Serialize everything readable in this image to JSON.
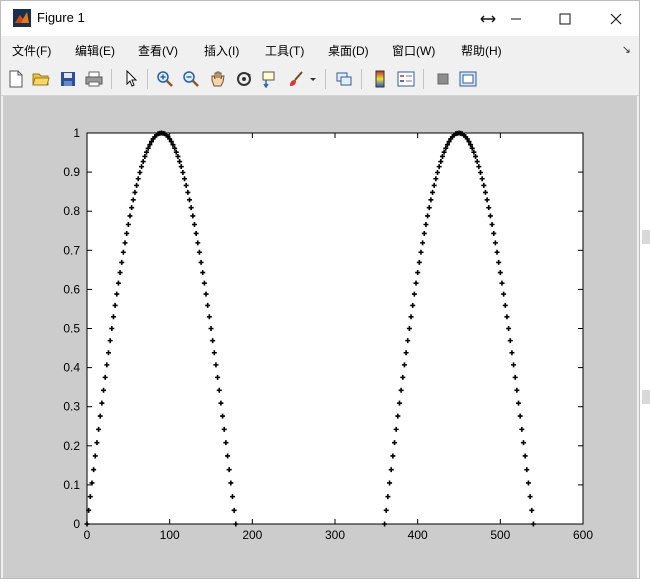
{
  "window": {
    "title": "Figure 1"
  },
  "menu": [
    {
      "id": "file",
      "label": "文件(F)"
    },
    {
      "id": "edit",
      "label": "编辑(E)"
    },
    {
      "id": "view",
      "label": "查看(V)"
    },
    {
      "id": "insert",
      "label": "插入(I)"
    },
    {
      "id": "tools",
      "label": "工具(T)"
    },
    {
      "id": "desktop",
      "label": "桌面(D)"
    },
    {
      "id": "window",
      "label": "窗口(W)"
    },
    {
      "id": "help",
      "label": "帮助(H)"
    }
  ],
  "toolbar": {
    "icons": [
      "new-figure-icon",
      "open-file-icon",
      "save-icon",
      "print-icon",
      "edit-plot-arrow-icon",
      "zoom-in-icon",
      "zoom-out-icon",
      "pan-hand-icon",
      "rotate-3d-icon",
      "data-cursor-icon",
      "brush-icon",
      "link-plot-icon",
      "colorbar-icon",
      "legend-icon",
      "hide-plot-tools-icon",
      "show-plot-tools-icon"
    ]
  },
  "colors": {
    "figure_background": "#cccccc",
    "axes_background": "#ffffff",
    "marker": "#000000"
  },
  "chart_data": {
    "type": "scatter",
    "title": "",
    "xlabel": "",
    "ylabel": "",
    "xlim": [
      0,
      600
    ],
    "ylim": [
      0,
      1
    ],
    "xticks": [
      0,
      100,
      200,
      300,
      400,
      500,
      600
    ],
    "yticks": [
      0,
      0.1,
      0.2,
      0.3,
      0.4,
      0.5,
      0.6,
      0.7,
      0.8,
      0.9,
      1
    ],
    "grid": false,
    "legend": "none",
    "marker": "+",
    "series": [
      {
        "description_of_points": "y = sin(x degrees) on arches where sin >= 0, sampled every 2 units",
        "x": [
          0,
          2,
          4,
          6,
          8,
          10,
          12,
          14,
          16,
          18,
          20,
          22,
          24,
          26,
          28,
          30,
          32,
          34,
          36,
          38,
          40,
          42,
          44,
          46,
          48,
          50,
          52,
          54,
          56,
          58,
          60,
          62,
          64,
          66,
          68,
          70,
          72,
          74,
          76,
          78,
          80,
          82,
          84,
          86,
          88,
          90,
          92,
          94,
          96,
          98,
          100,
          102,
          104,
          106,
          108,
          110,
          112,
          114,
          116,
          118,
          120,
          122,
          124,
          126,
          128,
          130,
          132,
          134,
          136,
          138,
          140,
          142,
          144,
          146,
          148,
          150,
          152,
          154,
          156,
          158,
          160,
          162,
          164,
          166,
          168,
          170,
          172,
          174,
          176,
          178,
          180,
          360,
          362,
          364,
          366,
          368,
          370,
          372,
          374,
          376,
          378,
          380,
          382,
          384,
          386,
          388,
          390,
          392,
          394,
          396,
          398,
          400,
          402,
          404,
          406,
          408,
          410,
          412,
          414,
          416,
          418,
          420,
          422,
          424,
          426,
          428,
          430,
          432,
          434,
          436,
          438,
          440,
          442,
          444,
          446,
          448,
          450,
          452,
          454,
          456,
          458,
          460,
          462,
          464,
          466,
          468,
          470,
          472,
          474,
          476,
          478,
          480,
          482,
          484,
          486,
          488,
          490,
          492,
          494,
          496,
          498,
          500,
          502,
          504,
          506,
          508,
          510,
          512,
          514,
          516,
          518,
          520,
          522,
          524,
          526,
          528,
          530,
          532,
          534,
          536,
          538,
          540
        ],
        "y": [
          0,
          0.035,
          0.07,
          0.105,
          0.139,
          0.174,
          0.208,
          0.242,
          0.276,
          0.309,
          0.342,
          0.375,
          0.407,
          0.438,
          0.469,
          0.5,
          0.53,
          0.559,
          0.588,
          0.616,
          0.643,
          0.669,
          0.695,
          0.719,
          0.743,
          0.766,
          0.788,
          0.809,
          0.829,
          0.848,
          0.866,
          0.883,
          0.899,
          0.914,
          0.927,
          0.94,
          0.951,
          0.961,
          0.97,
          0.978,
          0.985,
          0.99,
          0.995,
          0.998,
          0.999,
          1,
          0.999,
          0.998,
          0.995,
          0.99,
          0.985,
          0.978,
          0.97,
          0.961,
          0.951,
          0.94,
          0.927,
          0.914,
          0.899,
          0.883,
          0.866,
          0.848,
          0.829,
          0.809,
          0.788,
          0.766,
          0.743,
          0.719,
          0.695,
          0.669,
          0.643,
          0.616,
          0.588,
          0.559,
          0.53,
          0.5,
          0.469,
          0.438,
          0.407,
          0.375,
          0.342,
          0.309,
          0.276,
          0.242,
          0.208,
          0.174,
          0.139,
          0.105,
          0.07,
          0.035,
          0,
          0,
          0.035,
          0.07,
          0.105,
          0.139,
          0.174,
          0.208,
          0.242,
          0.276,
          0.309,
          0.342,
          0.375,
          0.407,
          0.438,
          0.469,
          0.5,
          0.53,
          0.559,
          0.588,
          0.616,
          0.643,
          0.669,
          0.695,
          0.719,
          0.743,
          0.766,
          0.788,
          0.809,
          0.829,
          0.848,
          0.866,
          0.883,
          0.899,
          0.914,
          0.927,
          0.94,
          0.951,
          0.961,
          0.97,
          0.978,
          0.985,
          0.99,
          0.995,
          0.998,
          0.999,
          1,
          0.999,
          0.998,
          0.995,
          0.99,
          0.985,
          0.978,
          0.97,
          0.961,
          0.951,
          0.94,
          0.927,
          0.914,
          0.899,
          0.883,
          0.866,
          0.848,
          0.829,
          0.809,
          0.788,
          0.766,
          0.743,
          0.719,
          0.695,
          0.669,
          0.643,
          0.616,
          0.588,
          0.559,
          0.53,
          0.5,
          0.469,
          0.438,
          0.407,
          0.375,
          0.342,
          0.309,
          0.276,
          0.242,
          0.208,
          0.174,
          0.139,
          0.105,
          0.07,
          0.035,
          0
        ]
      }
    ]
  }
}
